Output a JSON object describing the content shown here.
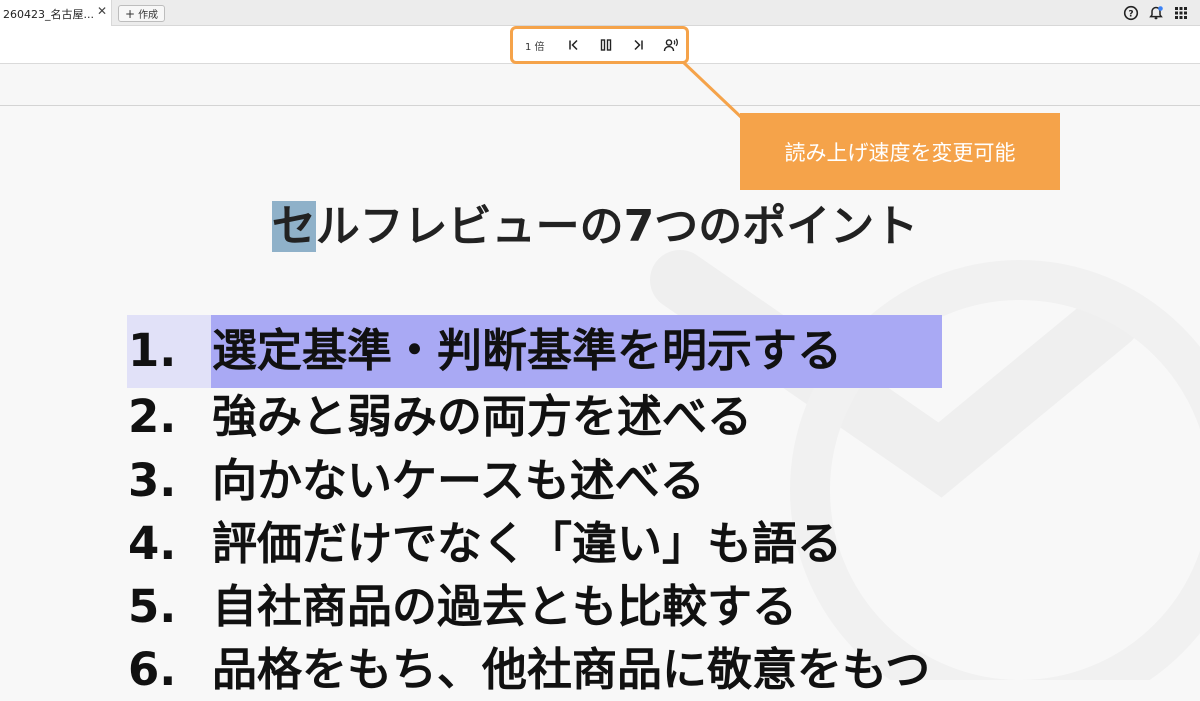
{
  "tab": {
    "title": "260423_名古屋...",
    "close_icon": "close-icon"
  },
  "new_button": {
    "label": "作成",
    "icon": "plus-icon"
  },
  "top_icons": [
    "help-icon",
    "bell-icon",
    "apps-grid-icon"
  ],
  "player": {
    "speed_label": "1 倍",
    "controls": [
      "skip-back-icon",
      "pause-icon",
      "skip-forward-icon",
      "voice-settings-icon"
    ]
  },
  "callout": {
    "text": "読み上げ速度を変更可能"
  },
  "slide": {
    "title_highlight": "セ",
    "title_rest": "ルフレビューの7つのポイント",
    "points": [
      {
        "num": "1.",
        "text": "選定基準・判断基準を明示する"
      },
      {
        "num": "2.",
        "text": "強みと弱みの両方を述べる"
      },
      {
        "num": "3.",
        "text": "向かないケースも述べる"
      },
      {
        "num": "4.",
        "text": "評価だけでなく「違い」も語る"
      },
      {
        "num": "5.",
        "text": "自社商品の過去とも比較する"
      },
      {
        "num": "6.",
        "text": "品格をもち、他社商品に敬意をもつ"
      }
    ]
  },
  "colors": {
    "callout": "#f5a34a",
    "highlight_row": "#a9a9f4",
    "highlight_char": "#8fb1c9"
  }
}
